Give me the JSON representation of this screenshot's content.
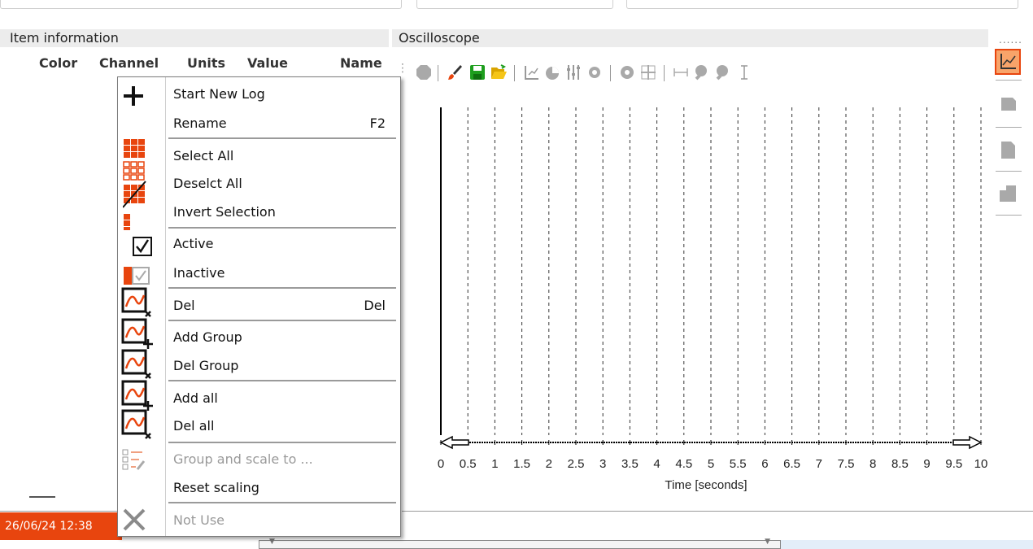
{
  "left_panel": {
    "title": "Item information",
    "columns": [
      "Color",
      "Channel",
      "Units",
      "Value",
      "Name"
    ],
    "status_time": "26/06/24 12:38"
  },
  "oscilloscope": {
    "title": "Oscilloscope",
    "toolbar_icons": [
      "stop-icon",
      "brush-icon",
      "save-icon",
      "open-folder-icon",
      "axis-icon",
      "pie-icon",
      "sliders-icon",
      "gear-icon",
      "gear-icon",
      "move-icon",
      "span-icon",
      "zoom-in-icon",
      "zoom-out-icon",
      "cursor-icon"
    ]
  },
  "chart_data": {
    "type": "line",
    "xlabel": "Time [seconds]",
    "xlim": [
      0,
      10
    ],
    "x_ticks": [
      "0",
      "0.5",
      "1",
      "1.5",
      "2",
      "2.5",
      "3",
      "3.5",
      "4",
      "4.5",
      "5",
      "5.5",
      "6",
      "6.5",
      "7",
      "7.5",
      "8",
      "8.5",
      "9",
      "9.5",
      "10"
    ],
    "grid": "vertical dashed",
    "series": []
  },
  "menu": {
    "items": [
      {
        "label": "Start New Log",
        "shortcut": "",
        "disabled": false,
        "icon": "plus-icon"
      },
      {
        "label": "Rename",
        "shortcut": "F2",
        "disabled": false,
        "icon": ""
      },
      {
        "label": "Select All",
        "shortcut": "",
        "disabled": false,
        "icon": "grid-full-icon"
      },
      {
        "label": "Deselct All",
        "shortcut": "",
        "disabled": false,
        "icon": "grid-empty-icon"
      },
      {
        "label": "Invert Selection",
        "shortcut": "",
        "disabled": false,
        "icon": "grid-invert-icon"
      },
      {
        "label": "Active",
        "shortcut": "",
        "disabled": false,
        "icon": "checkbox-checked-icon"
      },
      {
        "label": "Inactive",
        "shortcut": "",
        "disabled": false,
        "icon": "checkbox-grey-icon"
      },
      {
        "label": "Del",
        "shortcut": "Del",
        "disabled": false,
        "icon": "wave-delete-icon"
      },
      {
        "label": "Add Group",
        "shortcut": "",
        "disabled": false,
        "icon": "wave-add-icon"
      },
      {
        "label": "Del Group",
        "shortcut": "",
        "disabled": false,
        "icon": "wave-delete-icon"
      },
      {
        "label": "Add all",
        "shortcut": "",
        "disabled": false,
        "icon": "wave-add-icon"
      },
      {
        "label": "Del all",
        "shortcut": "",
        "disabled": false,
        "icon": "wave-delete-icon"
      },
      {
        "label": "Group and scale to ...",
        "shortcut": "",
        "disabled": true,
        "icon": "group-scale-icon"
      },
      {
        "label": "Reset scaling",
        "shortcut": "",
        "disabled": false,
        "icon": ""
      },
      {
        "label": "Not Use",
        "shortcut": "",
        "disabled": true,
        "icon": "cross-icon"
      }
    ]
  },
  "colors": {
    "accent": "#e8450e",
    "status_bg": "#e8450e",
    "save_green": "#1e9e1e"
  }
}
